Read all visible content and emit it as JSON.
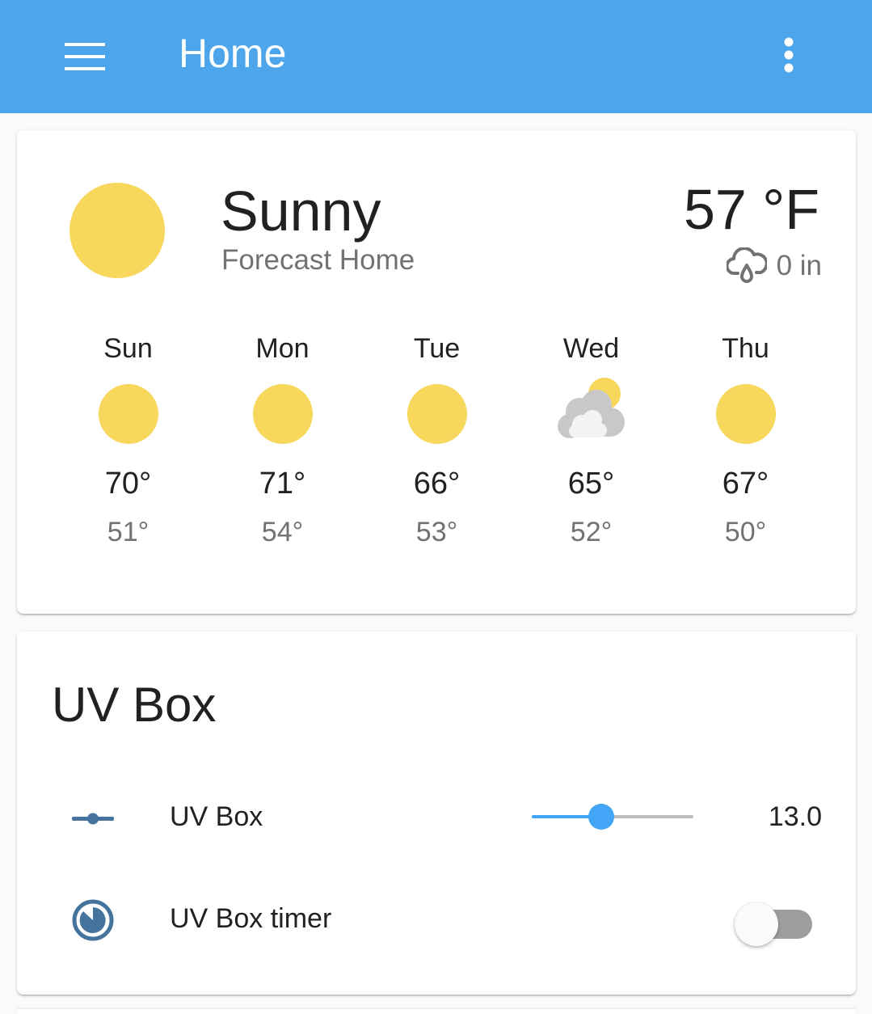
{
  "header": {
    "title": "Home",
    "menu_icon": "menu-icon",
    "overflow_icon": "more-vertical-icon",
    "background": "#4da6ec"
  },
  "weather": {
    "condition": "Sunny",
    "forecast_name": "Forecast Home",
    "temperature": "57 °F",
    "precipitation": "0 in",
    "current_icon": "sun-icon",
    "precip_icon": "rain-cloud-icon",
    "forecast": [
      {
        "day": "Sun",
        "icon": "sun-icon",
        "high": "70°",
        "low": "51°"
      },
      {
        "day": "Mon",
        "icon": "sun-icon",
        "high": "71°",
        "low": "54°"
      },
      {
        "day": "Tue",
        "icon": "sun-icon",
        "high": "66°",
        "low": "53°"
      },
      {
        "day": "Wed",
        "icon": "partly-cloudy-icon",
        "high": "65°",
        "low": "52°"
      },
      {
        "day": "Thu",
        "icon": "sun-icon",
        "high": "67°",
        "low": "50°"
      }
    ]
  },
  "uv_card": {
    "title": "UV Box",
    "slider_row": {
      "label": "UV Box",
      "value": "13.0",
      "icon": "slider-icon",
      "fraction": 0.43
    },
    "timer_row": {
      "label": "UV Box timer",
      "icon": "timer-icon",
      "state": "off"
    }
  },
  "colors": {
    "sun": "#f7d85c",
    "accent": "#42a5f5",
    "icon": "#44739e",
    "toggle_off_track": "#9e9e9e"
  }
}
